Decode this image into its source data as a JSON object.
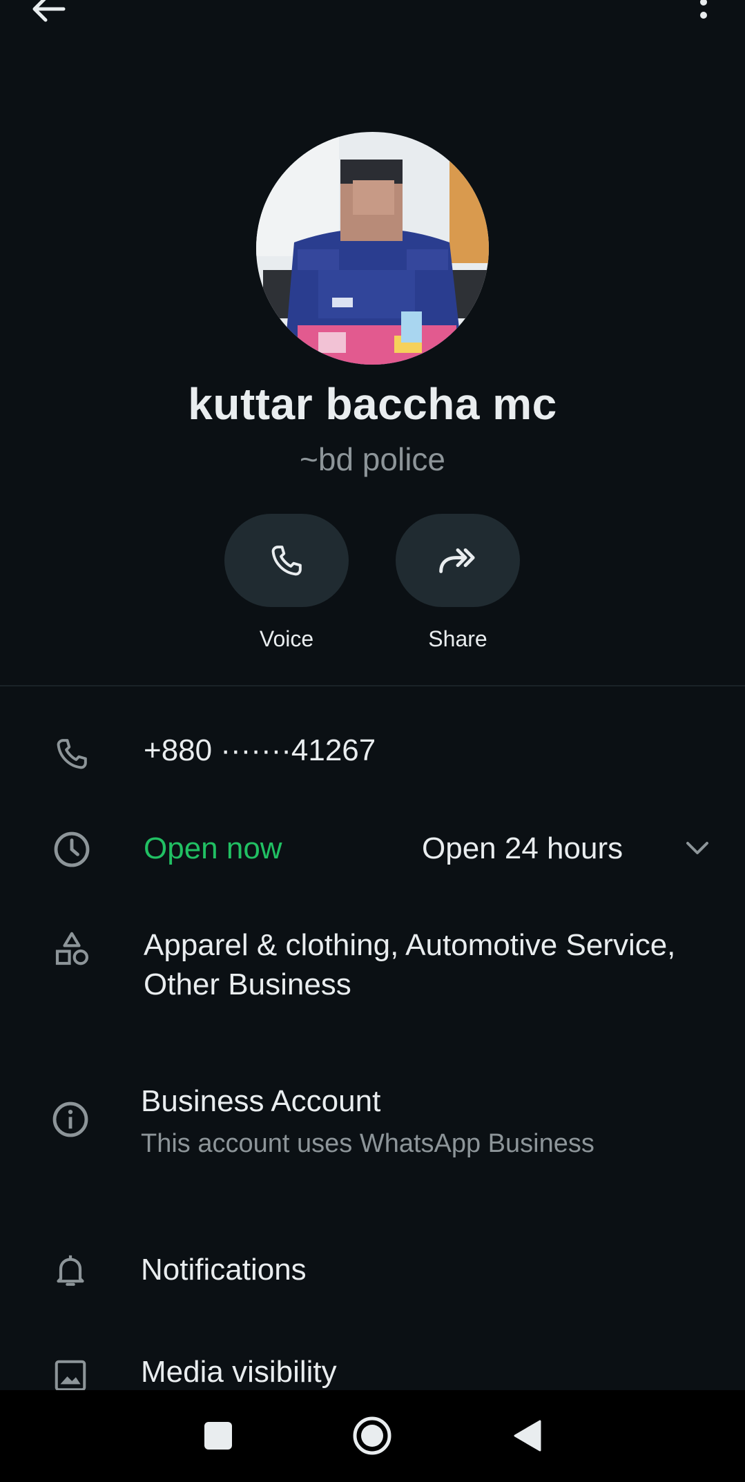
{
  "profile": {
    "name": "kuttar baccha mc",
    "subtitle": "~bd police"
  },
  "actions": {
    "voice_label": "Voice",
    "share_label": "Share"
  },
  "details": {
    "phone": "+880 ·······41267",
    "hours_status": "Open now",
    "hours_text": "Open 24 hours",
    "categories": "Apparel & clothing, Automotive Service, Other Business",
    "account_title": "Business Account",
    "account_desc": "This account uses WhatsApp Business"
  },
  "settings": {
    "notifications_label": "Notifications",
    "media_label": "Media visibility"
  },
  "colors": {
    "background": "#0b1014",
    "accent_green": "#21c063",
    "pill": "#202b31",
    "muted": "#8d9599"
  },
  "icons": {
    "back": "arrow-left-icon",
    "more": "more-vertical-icon",
    "voice": "phone-icon",
    "share": "share-forward-icon",
    "phone_row": "phone-icon",
    "hours": "clock-icon",
    "category": "shapes-icon",
    "info": "info-icon",
    "notifications": "bell-icon",
    "media": "image-icon",
    "nav_recents": "square-icon",
    "nav_home": "circle-icon",
    "nav_back": "triangle-back-icon"
  }
}
